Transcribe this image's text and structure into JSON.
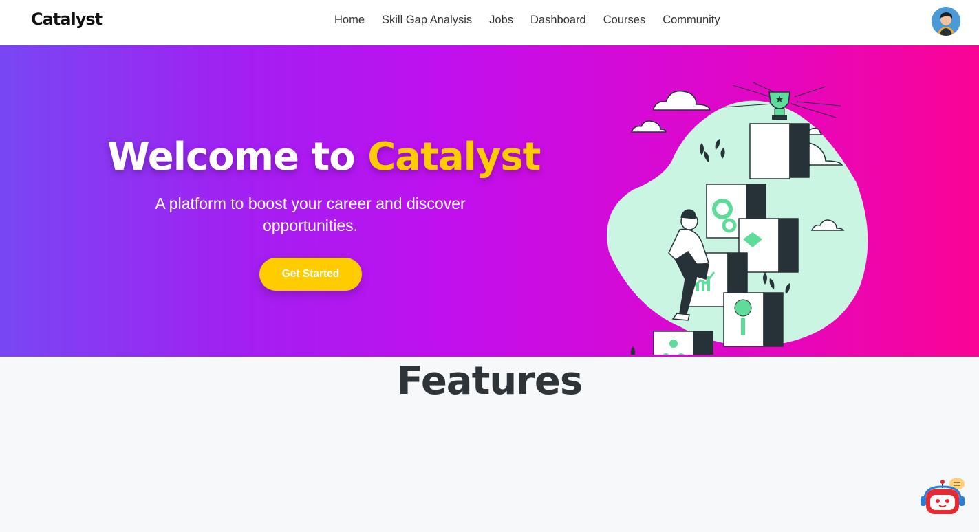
{
  "brand": {
    "name": "Catalyst"
  },
  "nav": {
    "items": [
      {
        "label": "Home"
      },
      {
        "label": "Skill Gap Analysis"
      },
      {
        "label": "Jobs"
      },
      {
        "label": "Dashboard"
      },
      {
        "label": "Courses"
      },
      {
        "label": "Community"
      }
    ]
  },
  "hero": {
    "title_prefix": "Welcome to ",
    "title_accent": "Catalyst",
    "subtitle": "A platform to boost your career and discover opportunities.",
    "cta_label": "Get Started"
  },
  "features": {
    "title": "Features"
  },
  "colors": {
    "accent": "#ffcc00",
    "gradient_start": "#7847f3",
    "gradient_end": "#fb0495",
    "illustration_blob": "#c9f5e2",
    "illustration_green": "#5fdc9a",
    "dark": "#263238"
  },
  "icons": {
    "avatar": "user-avatar",
    "chatbot": "robot-icon"
  }
}
